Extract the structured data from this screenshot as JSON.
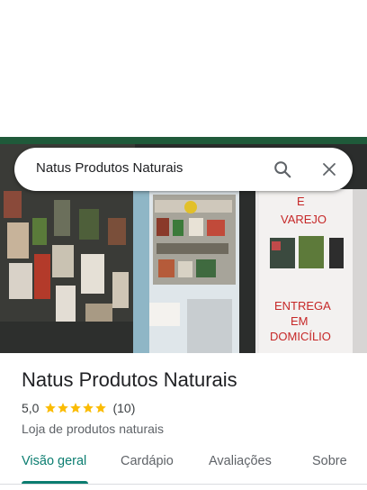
{
  "search": {
    "query": "Natus Produtos Naturais"
  },
  "icons": {
    "search": "search-icon",
    "close": "close-icon",
    "star": "star-icon"
  },
  "photo": {
    "sign_line1": "E",
    "sign_line2": "VAREJO",
    "sign_line3": "ENTREGA",
    "sign_line4": "EM",
    "sign_line5": "DOMICÍLIO"
  },
  "place": {
    "name": "Natus Produtos Naturais",
    "rating": "5,0",
    "stars": 5,
    "review_count": "(10)",
    "category": "Loja de produtos naturais"
  },
  "tabs": [
    {
      "label": "Visão geral",
      "active": true
    },
    {
      "label": "Cardápio",
      "active": false
    },
    {
      "label": "Avaliações",
      "active": false
    },
    {
      "label": "Sobre",
      "active": false
    }
  ],
  "colors": {
    "accent": "#0b7d70",
    "star": "#fbbc04",
    "sign_text": "#c62828"
  }
}
